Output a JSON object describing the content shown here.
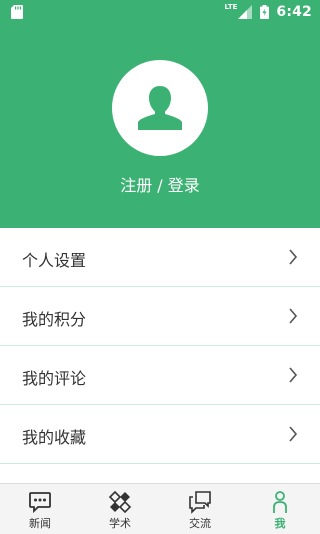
{
  "status_bar": {
    "network": "LTE",
    "time": "6:42",
    "icons": [
      "sd-card-icon",
      "signal-icon",
      "battery-icon"
    ]
  },
  "profile": {
    "avatar_icon": "user-icon",
    "login_label": "注册 / 登录"
  },
  "menu": {
    "items": [
      {
        "label": "个人设置"
      },
      {
        "label": "我的积分"
      },
      {
        "label": "我的评论"
      },
      {
        "label": "我的收藏"
      }
    ]
  },
  "tabs": {
    "active": "我",
    "items": [
      {
        "label": "新闻",
        "icon": "chat-bubble-icon"
      },
      {
        "label": "学术",
        "icon": "academic-icon"
      },
      {
        "label": "交流",
        "icon": "discussion-icon"
      },
      {
        "label": "我",
        "icon": "person-icon"
      }
    ]
  },
  "colors": {
    "primary": "#3bb273",
    "divider": "#cfe9de",
    "text": "#333333",
    "tabbar_bg": "#f4f4f4"
  }
}
